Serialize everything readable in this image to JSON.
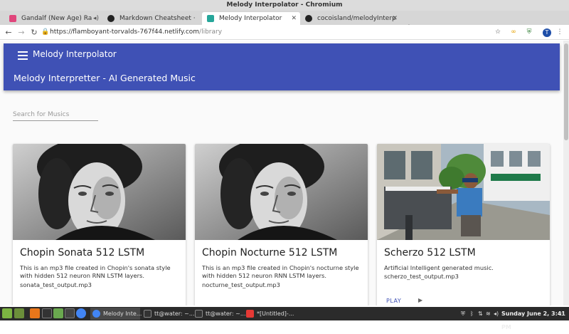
{
  "window": {
    "title": "Melody Interpolator - Chromium"
  },
  "tabs": [
    {
      "label": "Gandalf (New Age) Ra",
      "icon": "podcast-icon"
    },
    {
      "label": "Markdown Cheatsheet ·",
      "icon": "github-icon"
    },
    {
      "label": "Melody Interpolator",
      "icon": "netlify-icon"
    },
    {
      "label": "cocoisland/melodyInterp",
      "icon": "github-icon"
    }
  ],
  "toolbar": {
    "url_host": "https://flamboyant-torvalds-767f44.netlify.com",
    "url_path": "/library",
    "profile_initial": "T"
  },
  "app": {
    "title": "Melody Interpolator",
    "subtitle": "Melody Interpretter - AI Generated Music",
    "search_placeholder": "Search for Musics",
    "primary_color": "#3f51b5"
  },
  "cards": [
    {
      "title": "Chopin Sonata 512 LSTM",
      "description": "This is an mp3 file created in Chopin's sonata style with hidden 512 neuron RNN LSTM layers.",
      "file": "sonata_test_output.mp3"
    },
    {
      "title": "Chopin Nocturne 512 LSTM",
      "description": "This is an mp3 file created in Chopin's nocturne style with hidden 512 neuron RNN LSTM layers.",
      "file": "nocturne_test_output.mp3"
    },
    {
      "title": "Scherzo 512 LSTM",
      "description": "Artificial Intelligent generated music.",
      "file": "scherzo_test_output.mp3",
      "play_label": "PLAY"
    }
  ],
  "taskbar": {
    "tasks": [
      {
        "label": "Melody Inte..."
      },
      {
        "label": "tt@water: ~..."
      },
      {
        "label": "tt@water: ~..."
      },
      {
        "label": "*[Untitled]-..."
      }
    ],
    "clock": "Sunday June 2,  3:41 PM"
  }
}
